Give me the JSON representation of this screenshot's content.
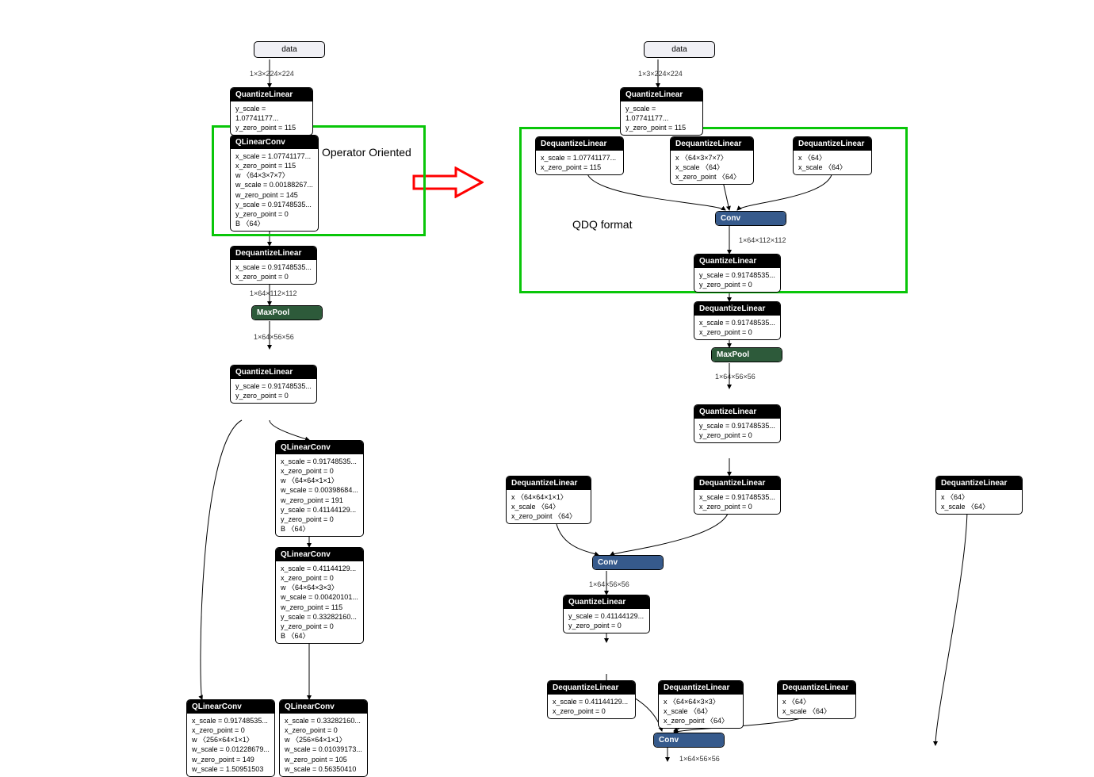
{
  "left": {
    "label": "Operator Oriented",
    "data": "data",
    "shape1": "1×3×224×224",
    "ql1": {
      "title": "QuantizeLinear",
      "p": [
        "y_scale = 1.07741177...",
        "y_zero_point = 115"
      ]
    },
    "qlc1": {
      "title": "QLinearConv",
      "p": [
        "x_scale = 1.07741177...",
        "x_zero_point = 115",
        "w 〈64×3×7×7〉",
        "w_scale = 0.00188267...",
        "w_zero_point = 145",
        "y_scale = 0.91748535...",
        "y_zero_point = 0",
        "B 〈64〉"
      ]
    },
    "dq1": {
      "title": "DequantizeLinear",
      "p": [
        "x_scale = 0.91748535...",
        "x_zero_point = 0"
      ]
    },
    "shape2": "1×64×112×112",
    "mp": "MaxPool",
    "shape3": "1×64×56×56",
    "ql2": {
      "title": "QuantizeLinear",
      "p": [
        "y_scale = 0.91748535...",
        "y_zero_point = 0"
      ]
    },
    "qlc2": {
      "title": "QLinearConv",
      "p": [
        "x_scale = 0.91748535...",
        "x_zero_point = 0",
        "w 〈64×64×1×1〉",
        "w_scale = 0.00398684...",
        "w_zero_point = 191",
        "y_scale = 0.41144129...",
        "y_zero_point = 0",
        "B 〈64〉"
      ]
    },
    "qlc3": {
      "title": "QLinearConv",
      "p": [
        "x_scale = 0.41144129...",
        "x_zero_point = 0",
        "w 〈64×64×3×3〉",
        "w_scale = 0.00420101...",
        "w_zero_point = 115",
        "y_scale = 0.33282160...",
        "y_zero_point = 0",
        "B 〈64〉"
      ]
    },
    "qlc4": {
      "title": "QLinearConv",
      "p": [
        "x_scale = 0.91748535...",
        "x_zero_point = 0",
        "w 〈256×64×1×1〉",
        "w_scale = 0.01228679...",
        "w_zero_point = 149",
        "w_scale = 1.50951503"
      ]
    },
    "qlc5": {
      "title": "QLinearConv",
      "p": [
        "x_scale = 0.33282160...",
        "x_zero_point = 0",
        "w 〈256×64×1×1〉",
        "w_scale = 0.01039173...",
        "w_zero_point = 105",
        "w_scale = 0.56350410"
      ]
    }
  },
  "right": {
    "label": "QDQ format",
    "data": "data",
    "shape1": "1×3×224×224",
    "ql1": {
      "title": "QuantizeLinear",
      "p": [
        "y_scale = 1.07741177...",
        "y_zero_point = 115"
      ]
    },
    "dq1": {
      "title": "DequantizeLinear",
      "p": [
        "x_scale = 1.07741177...",
        "x_zero_point = 115"
      ]
    },
    "dq2": {
      "title": "DequantizeLinear",
      "p": [
        "x 〈64×3×7×7〉",
        "x_scale 〈64〉",
        "x_zero_point 〈64〉"
      ]
    },
    "dq3": {
      "title": "DequantizeLinear",
      "p": [
        "x 〈64〉",
        "x_scale 〈64〉"
      ]
    },
    "conv1": "Conv",
    "shape2": "1×64×112×112",
    "ql2": {
      "title": "QuantizeLinear",
      "p": [
        "y_scale = 0.91748535...",
        "y_zero_point = 0"
      ]
    },
    "dq4": {
      "title": "DequantizeLinear",
      "p": [
        "x_scale = 0.91748535...",
        "x_zero_point = 0"
      ]
    },
    "mp": "MaxPool",
    "shape3": "1×64×56×56",
    "ql3": {
      "title": "QuantizeLinear",
      "p": [
        "y_scale = 0.91748535...",
        "y_zero_point = 0"
      ]
    },
    "dq5": {
      "title": "DequantizeLinear",
      "p": [
        "x 〈64×64×1×1〉",
        "x_scale 〈64〉",
        "x_zero_point 〈64〉"
      ]
    },
    "dq6": {
      "title": "DequantizeLinear",
      "p": [
        "x_scale = 0.91748535...",
        "x_zero_point = 0"
      ]
    },
    "dq7": {
      "title": "DequantizeLinear",
      "p": [
        "x 〈64〉",
        "x_scale 〈64〉"
      ]
    },
    "conv2": "Conv",
    "shape4": "1×64×56×56",
    "ql4": {
      "title": "QuantizeLinear",
      "p": [
        "y_scale = 0.41144129...",
        "y_zero_point = 0"
      ]
    },
    "dq8": {
      "title": "DequantizeLinear",
      "p": [
        "x_scale = 0.41144129...",
        "x_zero_point = 0"
      ]
    },
    "dq9": {
      "title": "DequantizeLinear",
      "p": [
        "x 〈64×64×3×3〉",
        "x_scale 〈64〉",
        "x_zero_point 〈64〉"
      ]
    },
    "dq10": {
      "title": "DequantizeLinear",
      "p": [
        "x 〈64〉",
        "x_scale 〈64〉"
      ]
    },
    "conv3": "Conv",
    "shape5": "1×64×56×56"
  }
}
